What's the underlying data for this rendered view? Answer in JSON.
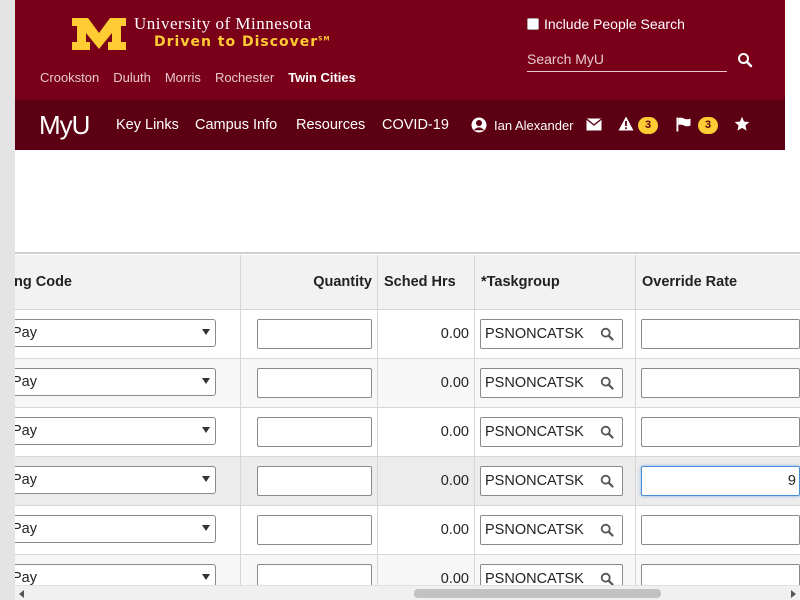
{
  "header": {
    "university_name": "University of Minnesota",
    "tagline": "Driven to Discover",
    "tagline_mark": "SM",
    "campuses": [
      "Crookston",
      "Duluth",
      "Morris",
      "Rochester",
      "Twin Cities"
    ],
    "active_campus": "Twin Cities",
    "include_people_label": "Include People Search",
    "search_placeholder": "Search MyU"
  },
  "nav": {
    "brand": "MyU",
    "items": [
      "Key Links",
      "Campus Info",
      "Resources",
      "COVID-19"
    ],
    "user_name": "Ian Alexander",
    "alerts_count": "3",
    "flags_count": "3"
  },
  "table": {
    "columns": [
      "ng Code",
      "Quantity",
      "Sched Hrs",
      "*Taskgroup",
      "Override Rate"
    ],
    "rows": [
      {
        "code": "Pay",
        "quantity": "",
        "sched_hrs": "0.00",
        "taskgroup": "PSNONCATSK",
        "override_rate": ""
      },
      {
        "code": "Pay",
        "quantity": "",
        "sched_hrs": "0.00",
        "taskgroup": "PSNONCATSK",
        "override_rate": ""
      },
      {
        "code": "Pay",
        "quantity": "",
        "sched_hrs": "0.00",
        "taskgroup": "PSNONCATSK",
        "override_rate": ""
      },
      {
        "code": "Pay",
        "quantity": "",
        "sched_hrs": "0.00",
        "taskgroup": "PSNONCATSK",
        "override_rate": "9"
      },
      {
        "code": "Pay",
        "quantity": "",
        "sched_hrs": "0.00",
        "taskgroup": "PSNONCATSK",
        "override_rate": ""
      },
      {
        "code": "Pay",
        "quantity": "",
        "sched_hrs": "0.00",
        "taskgroup": "PSNONCATSK",
        "override_rate": ""
      }
    ]
  },
  "colors": {
    "maroon": "#7a0019",
    "dark_maroon": "#5c0013",
    "gold": "#ffcc33"
  }
}
